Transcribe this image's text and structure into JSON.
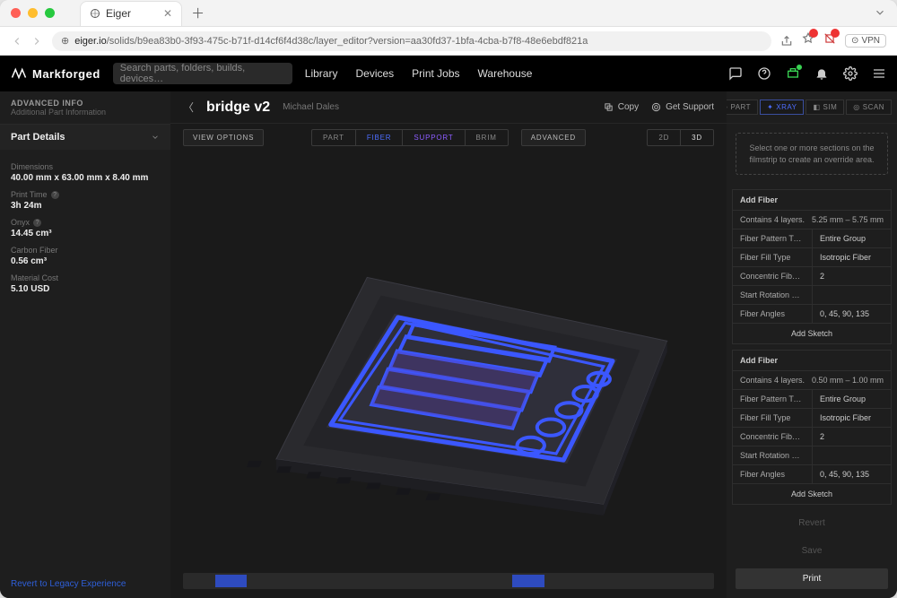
{
  "browser": {
    "tab_title": "Eiger",
    "url_prefix": "eiger.io",
    "url_path": "/solids/b9ea83b0-3f93-475c-b71f-d14cf6f4d38c/layer_editor?version=aa30fd37-1bfa-4cba-b7f8-48e6ebdf821a",
    "vpn": "VPN"
  },
  "header": {
    "brand": "Markforged",
    "search_placeholder": "Search parts, folders, builds, devices…",
    "nav": [
      "Library",
      "Devices",
      "Print Jobs",
      "Warehouse"
    ]
  },
  "sidebar": {
    "advanced_title": "ADVANCED INFO",
    "advanced_sub": "Additional Part Information",
    "section": "Part Details",
    "items": [
      {
        "label": "Dimensions",
        "value": "40.00 mm x 63.00 mm x 8.40 mm"
      },
      {
        "label": "Print Time",
        "value": "3h 24m"
      },
      {
        "label": "Onyx",
        "value": "14.45 cm³"
      },
      {
        "label": "Carbon Fiber",
        "value": "0.56 cm³"
      },
      {
        "label": "Material Cost",
        "value": "5.10 USD"
      }
    ],
    "legacy_link": "Revert to Legacy Experience"
  },
  "titlebar": {
    "name": "bridge v2",
    "owner": "Michael Dales",
    "copy": "Copy",
    "support": "Get Support"
  },
  "toolbar": {
    "view_options": "VIEW OPTIONS",
    "modes": {
      "part": "PART",
      "fiber": "FIBER",
      "support": "SUPPORT",
      "brim": "BRIM"
    },
    "advanced": "ADVANCED",
    "dims": {
      "d2": "2D",
      "d3": "3D"
    }
  },
  "right": {
    "modes": {
      "part": "PART",
      "xray": "XRAY",
      "sim": "SIM",
      "scan": "SCAN"
    },
    "hint": "Select one or more sections on the filmstrip to create an override area.",
    "groups": [
      {
        "title": "Add Fiber",
        "contains": "Contains 4 layers.",
        "range": "5.25 mm – 5.75 mm",
        "rows": [
          {
            "k": "Fiber Pattern Type",
            "v": "Entire Group"
          },
          {
            "k": "Fiber Fill Type",
            "v": "Isotropic Fiber"
          },
          {
            "k": "Concentric Fiber R…",
            "v": "2"
          },
          {
            "k": "Start Rotation Per…",
            "v": ""
          },
          {
            "k": "Fiber Angles",
            "v": "0, 45, 90, 135"
          }
        ],
        "sketch": "Add Sketch"
      },
      {
        "title": "Add Fiber",
        "contains": "Contains 4 layers.",
        "range": "0.50 mm – 1.00 mm",
        "rows": [
          {
            "k": "Fiber Pattern Type",
            "v": "Entire Group"
          },
          {
            "k": "Fiber Fill Type",
            "v": "Isotropic Fiber"
          },
          {
            "k": "Concentric Fiber R…",
            "v": "2"
          },
          {
            "k": "Start Rotation Per…",
            "v": ""
          },
          {
            "k": "Fiber Angles",
            "v": "0, 45, 90, 135"
          }
        ],
        "sketch": "Add Sketch"
      }
    ],
    "actions": {
      "revert": "Revert",
      "save": "Save",
      "print": "Print"
    }
  }
}
